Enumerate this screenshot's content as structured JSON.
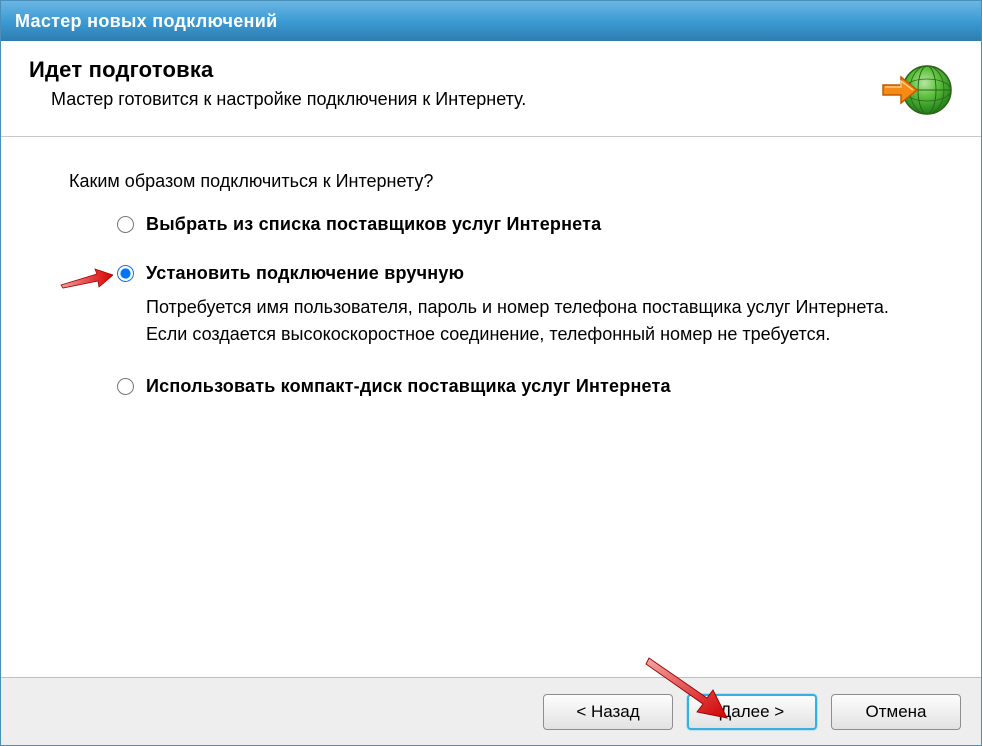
{
  "titlebar": {
    "title": "Мастер новых подключений"
  },
  "header": {
    "title": "Идет подготовка",
    "subtitle": "Мастер готовится к настройке подключения к Интернету."
  },
  "body": {
    "question": "Каким образом подключиться к Интернету?",
    "options": [
      {
        "label": "Выбрать из списка поставщиков услуг Интернета",
        "desc": "",
        "checked": false
      },
      {
        "label": "Установить подключение вручную",
        "desc": "Потребуется имя пользователя, пароль и номер телефона поставщика услуг Интернета. Если создается высокоскоростное соединение, телефонный номер не требуется.",
        "checked": true
      },
      {
        "label": "Использовать компакт-диск поставщика услуг Интернета",
        "desc": "",
        "checked": false
      }
    ]
  },
  "buttons": {
    "back": "< Назад",
    "next": "Далее >",
    "cancel": "Отмена"
  }
}
